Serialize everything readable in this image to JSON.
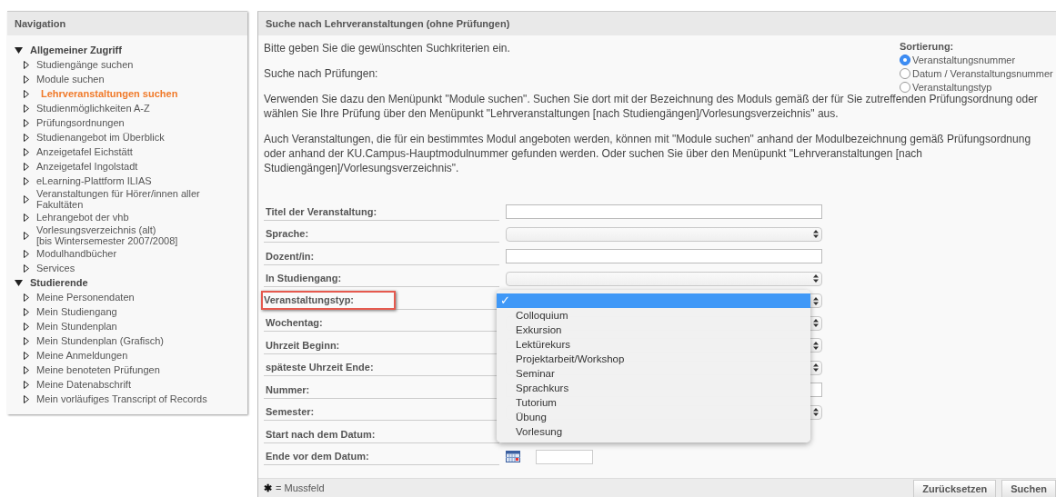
{
  "navigation": {
    "title": "Navigation",
    "groups": [
      {
        "label": "Allgemeiner Zugriff",
        "expanded": true,
        "items": [
          {
            "label": "Studiengänge suchen",
            "selected": false
          },
          {
            "label": "Module suchen",
            "selected": false
          },
          {
            "label": "Lehrveranstaltungen suchen",
            "selected": true
          },
          {
            "label": "Studienmöglichkeiten A-Z",
            "selected": false
          },
          {
            "label": "Prüfungsordnungen",
            "selected": false
          },
          {
            "label": "Studienangebot im Überblick",
            "selected": false
          },
          {
            "label": "Anzeigetafel Eichstätt",
            "selected": false
          },
          {
            "label": "Anzeigetafel Ingolstadt",
            "selected": false
          },
          {
            "label": "eLearning-Plattform ILIAS",
            "selected": false
          },
          {
            "label": "Veranstaltungen für Hörer/innen aller Fakultäten",
            "selected": false
          },
          {
            "label": "Lehrangebot der vhb",
            "selected": false
          },
          {
            "label": "Vorlesungsverzeichnis (alt)\n[bis Wintersemester 2007/2008]",
            "selected": false
          },
          {
            "label": "Modulhandbücher",
            "selected": false
          },
          {
            "label": "Services",
            "selected": false
          }
        ]
      },
      {
        "label": "Studierende",
        "expanded": true,
        "items": [
          {
            "label": "Meine Personendaten",
            "selected": false
          },
          {
            "label": "Mein Studiengang",
            "selected": false
          },
          {
            "label": "Mein Stundenplan",
            "selected": false
          },
          {
            "label": "Mein Stundenplan (Grafisch)",
            "selected": false
          },
          {
            "label": "Meine Anmeldungen",
            "selected": false
          },
          {
            "label": "Meine benoteten Prüfungen",
            "selected": false
          },
          {
            "label": "Meine Datenabschrift",
            "selected": false
          },
          {
            "label": "Mein vorläufiges Transcript of Records",
            "selected": false
          }
        ]
      }
    ]
  },
  "main": {
    "title": "Suche nach Lehrveranstaltungen (ohne Prüfungen)",
    "paragraphs": [
      "Bitte geben Sie die gewünschten Suchkriterien ein.",
      "Suche nach Prüfungen:",
      "Verwenden Sie dazu den Menüpunkt \"Module suchen\". Suchen Sie dort mit der Bezeichnung des Moduls gemäß der für Sie zutreffenden Prüfungsordnung oder wählen Sie Ihre Prüfung über den Menüpunkt \"Lehrveranstaltungen [nach Studiengängen]/Vorlesungsverzeichnis\" aus.",
      "Auch Veranstaltungen, die für ein bestimmtes Modul angeboten werden, können mit \"Module suchen\" anhand der Modulbezeichnung gemäß Prüfungsordnung oder anhand der KU.Campus-Hauptmodulnummer gefunden werden. Oder suchen Sie über den Menüpunkt \"Lehrveranstaltungen [nach Studiengängen]/Vorlesungsverzeichnis\"."
    ],
    "sorting": {
      "title": "Sortierung:",
      "options": [
        {
          "label": "Veranstaltungsnummer",
          "selected": true
        },
        {
          "label": "Datum / Veranstaltungsnummer",
          "selected": false
        },
        {
          "label": "Veranstaltungstyp",
          "selected": false
        }
      ]
    },
    "fields": [
      {
        "label": "Titel der Veranstaltung:",
        "kind": "text",
        "highlighted": false
      },
      {
        "label": "Sprache:",
        "kind": "select",
        "highlighted": false
      },
      {
        "label": "Dozent/in:",
        "kind": "text",
        "highlighted": false
      },
      {
        "label": "In Studiengang:",
        "kind": "select",
        "highlighted": false
      },
      {
        "label": "Veranstaltungstyp:",
        "kind": "select",
        "highlighted": true
      },
      {
        "label": "Wochentag:",
        "kind": "select",
        "highlighted": false
      },
      {
        "label": "Uhrzeit Beginn:",
        "kind": "select",
        "highlighted": false
      },
      {
        "label": "späteste Uhrzeit Ende:",
        "kind": "select",
        "highlighted": false
      },
      {
        "label": "Nummer:",
        "kind": "text",
        "highlighted": false
      },
      {
        "label": "Semester:",
        "kind": "select",
        "highlighted": false
      },
      {
        "label": "Start nach dem Datum:",
        "highlighted": false
      },
      {
        "label": "Ende vor dem Datum:",
        "kind": "date",
        "highlighted": false
      }
    ],
    "dropdown": {
      "options": [
        {
          "mark": "✓",
          "selected": true
        },
        {
          "label": "Colloquium",
          "selected": false
        },
        {
          "label": "Exkursion",
          "selected": false
        },
        {
          "label": "Lektürekurs",
          "selected": false
        },
        {
          "label": "Projektarbeit/Workshop",
          "selected": false
        },
        {
          "label": "Seminar",
          "selected": false
        },
        {
          "label": "Sprachkurs",
          "selected": false
        },
        {
          "label": "Tutorium",
          "selected": false
        },
        {
          "label": "Übung",
          "selected": false
        },
        {
          "label": "Vorlesung",
          "selected": false
        }
      ]
    },
    "footer": {
      "note_mark": "✱",
      "note": "= Mussfeld",
      "buttons": [
        "Zurücksetzen",
        "Suchen"
      ]
    }
  }
}
